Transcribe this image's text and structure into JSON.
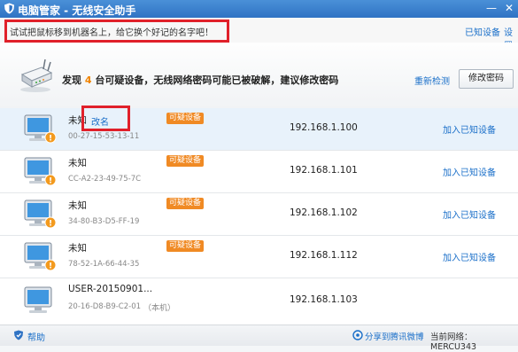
{
  "window": {
    "title": "电脑管家 - 无线安全助手",
    "minimize": "—",
    "close": "✕"
  },
  "hint": {
    "text": "试试把鼠标移到机器名上，给它换个好记的名字吧！",
    "known_devices": "已知设备",
    "settings": "设置"
  },
  "banner": {
    "prefix": "发现",
    "count": "4",
    "message": "台可疑设备，无线网络密码可能已被破解，建议修改密码",
    "recheck": "重新检测",
    "change_password": "修改密码"
  },
  "colors": {
    "accent": "#1a6fc9",
    "warning": "#f08a24",
    "highlight": "#e0202a"
  },
  "devices": [
    {
      "name": "未知",
      "mac": "00-27-15-53-13-11",
      "badge": "可疑设备",
      "ip": "192.168.1.100",
      "action": "加入已知设备",
      "rename": "改名"
    },
    {
      "name": "未知",
      "mac": "CC-A2-23-49-75-7C",
      "badge": "可疑设备",
      "ip": "192.168.1.101",
      "action": "加入已知设备"
    },
    {
      "name": "未知",
      "mac": "34-80-B3-D5-FF-19",
      "badge": "可疑设备",
      "ip": "192.168.1.102",
      "action": "加入已知设备"
    },
    {
      "name": "未知",
      "mac": "78-52-1A-66-44-35",
      "badge": "可疑设备",
      "ip": "192.168.1.112",
      "action": "加入已知设备"
    },
    {
      "name": "USER-20150901...",
      "mac": "20-16-D8-B9-C2-01",
      "suffix": "（本机）",
      "ip": "192.168.1.103"
    }
  ],
  "footer": {
    "help": "帮助",
    "share": "分享到腾讯微博",
    "network_label": "当前网络：",
    "network_name": "MERCU343"
  }
}
